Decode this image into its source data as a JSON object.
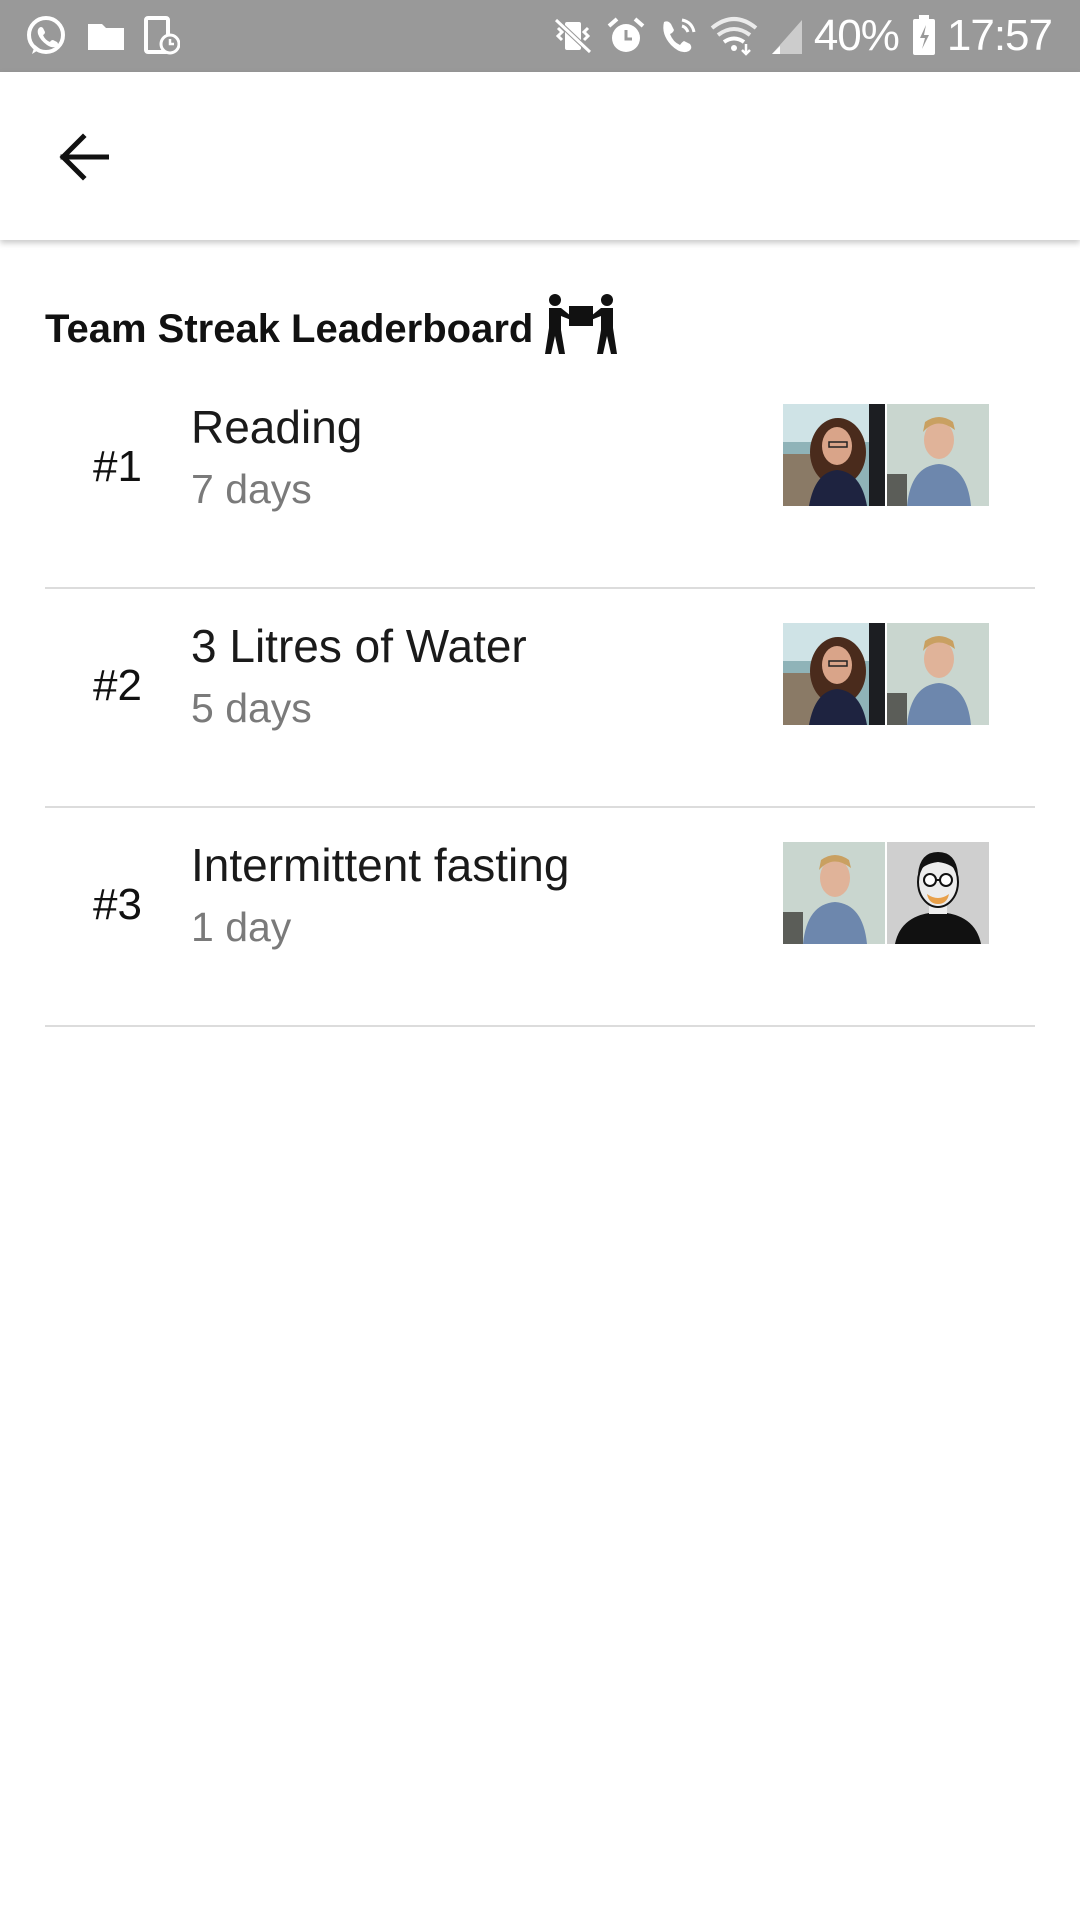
{
  "status_bar": {
    "left_icons": [
      "whatsapp-icon",
      "folder-icon",
      "device-clock-icon"
    ],
    "right_icons": [
      "vibrate-icon",
      "alarm-icon",
      "wifi-call-icon",
      "wifi-icon",
      "signal-icon"
    ],
    "battery": "40%",
    "time": "17:57"
  },
  "app_bar": {
    "back_icon": "arrow-left-icon"
  },
  "section": {
    "title": "Team Streak Leaderboard",
    "title_icon": "people-carrying-box-icon"
  },
  "leaderboard": [
    {
      "rank": "#1",
      "name": "Reading",
      "days": "7 days",
      "avatars": [
        "woman-photo",
        "man-photo"
      ]
    },
    {
      "rank": "#2",
      "name": "3 Litres of Water",
      "days": "5 days",
      "avatars": [
        "woman-photo",
        "man-photo"
      ]
    },
    {
      "rank": "#3",
      "name": "Intermittent fasting",
      "days": "1 day",
      "avatars": [
        "man-photo",
        "cartoon-man-glasses"
      ]
    }
  ],
  "colors": {
    "status_bar_bg": "#999999",
    "divider": "#dcdcdc",
    "secondary_text": "#7a7a7a"
  }
}
